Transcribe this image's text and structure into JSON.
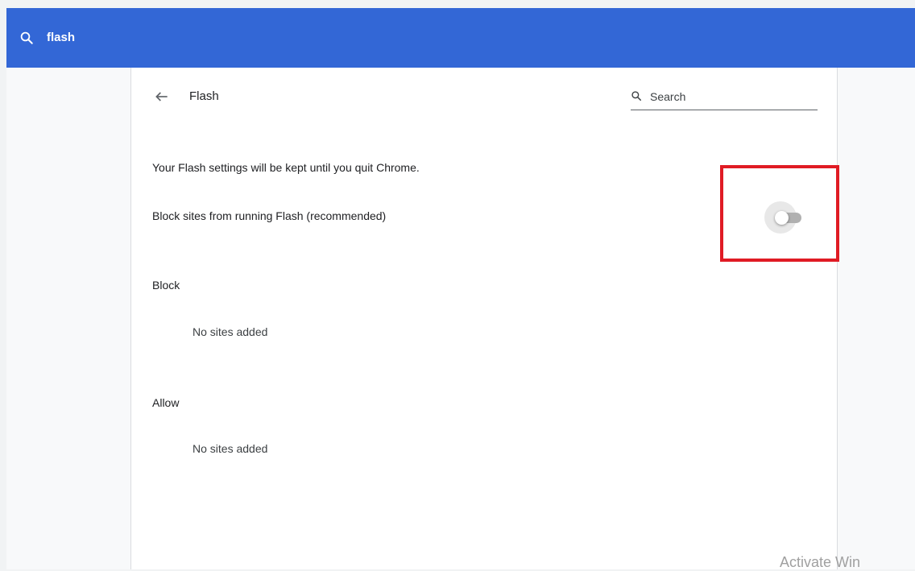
{
  "topbar": {
    "query": "flash",
    "color": "#3367d6"
  },
  "page": {
    "title": "Flash",
    "search_placeholder": "Search",
    "info": "Your Flash settings will be kept until you quit Chrome.",
    "toggle_label": "Block sites from running Flash (recommended)",
    "toggle_state": "off"
  },
  "sections": {
    "block": {
      "heading": "Block",
      "empty": "No sites added"
    },
    "allow": {
      "heading": "Allow",
      "empty": "No sites added"
    }
  },
  "watermark": "Activate Win",
  "icons": {
    "topbar_search": "search-icon",
    "back": "arrow-back-icon",
    "page_search": "search-icon"
  }
}
